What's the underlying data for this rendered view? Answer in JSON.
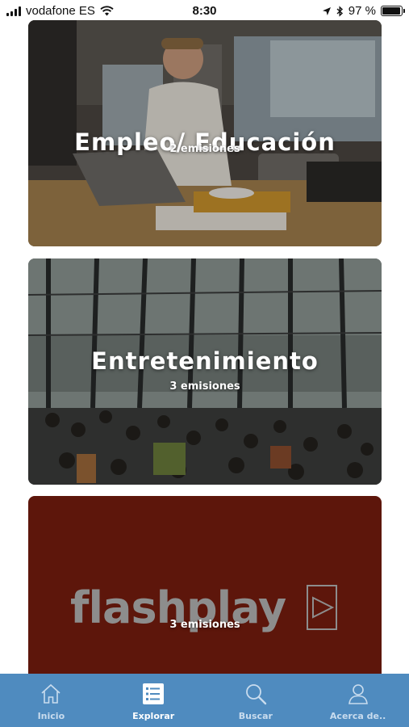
{
  "status_bar": {
    "carrier": "vodafone ES",
    "time": "8:30",
    "battery": "97 %",
    "battery_level": 0.97,
    "icons": [
      "signal-icon",
      "wifi-icon",
      "location-icon",
      "bluetooth-icon",
      "battery-icon"
    ]
  },
  "cards": [
    {
      "title": "Empleo/ Educación",
      "subtitle": "2 emisiones",
      "image": "office-worker-with-laptop-photo"
    },
    {
      "title": "Entretenimiento",
      "subtitle": "3 emisiones",
      "image": "busy-atrium-crowd-photo"
    },
    {
      "logo": "flashplay",
      "subtitle": "3 emisiones",
      "background_color": "#5d160b",
      "logo_color": "#8d8d8d"
    }
  ],
  "tab_bar": {
    "background_color": "#4f8bbf",
    "tabs": [
      {
        "label": "Inicio",
        "icon": "home-icon",
        "active": false
      },
      {
        "label": "Explorar",
        "icon": "list-icon",
        "active": true
      },
      {
        "label": "Buscar",
        "icon": "search-icon",
        "active": false
      },
      {
        "label": "Acerca de..",
        "icon": "user-icon",
        "active": false
      }
    ]
  }
}
